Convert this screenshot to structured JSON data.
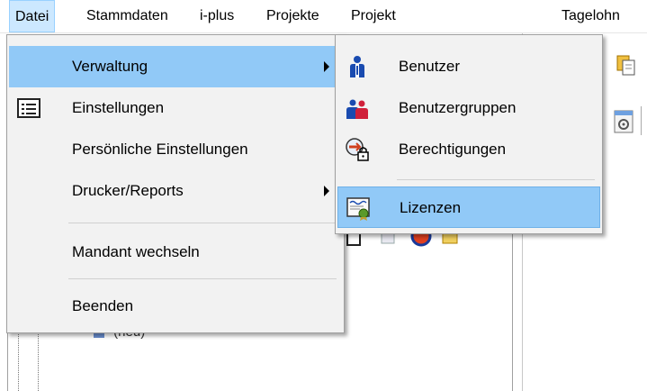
{
  "menubar": {
    "items": [
      {
        "label": "Datei"
      },
      {
        "label": "Stammdaten"
      },
      {
        "label": "i-plus"
      },
      {
        "label": "Projekte"
      },
      {
        "label": "Projekt"
      },
      {
        "label": "Tagelohn"
      }
    ]
  },
  "datei_menu": {
    "items": [
      {
        "label": "Verwaltung",
        "submenu": true,
        "icon": "none"
      },
      {
        "label": "Einstellungen",
        "icon": "list-settings-icon"
      },
      {
        "label": "Persönliche Einstellungen",
        "icon": "none"
      },
      {
        "label": "Drucker/Reports",
        "submenu": true,
        "icon": "none"
      },
      {
        "label": "Mandant wechseln",
        "icon": "none"
      },
      {
        "label": "Beenden",
        "icon": "none"
      }
    ]
  },
  "verwaltung_menu": {
    "items": [
      {
        "label": "Benutzer",
        "icon": "user-icon"
      },
      {
        "label": "Benutzergruppen",
        "icon": "user-group-icon"
      },
      {
        "label": "Berechtigungen",
        "icon": "permissions-lock-icon"
      },
      {
        "label": "Lizenzen",
        "icon": "license-certificate-icon"
      }
    ]
  },
  "background": {
    "tree_node_label": "(neu)"
  },
  "colors": {
    "highlight": "#91c9f7",
    "menu_bg": "#f2f2f2",
    "menubar_active": "#cce8ff"
  }
}
